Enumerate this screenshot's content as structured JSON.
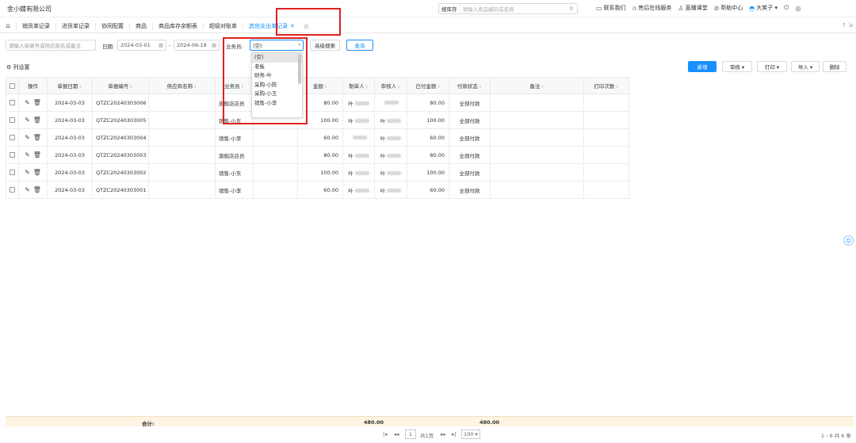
{
  "company": "金小蝶有限公司",
  "top_search": {
    "scope": "搜库存",
    "placeholder": "请输入商品编码或名称"
  },
  "top_links": [
    {
      "icon": "message-icon",
      "label": "联系我们"
    },
    {
      "icon": "headset-icon",
      "label": "售后在线服务"
    },
    {
      "icon": "live-icon",
      "label": "直播课堂"
    },
    {
      "icon": "help-icon",
      "label": "帮助中心"
    },
    {
      "icon": "user-icon",
      "label": "大笑子 ▾"
    }
  ],
  "tabs": [
    {
      "label": "销货单记录",
      "active": false
    },
    {
      "label": "进货单记录",
      "active": false
    },
    {
      "label": "协同配置",
      "active": false
    },
    {
      "label": "商品",
      "active": false
    },
    {
      "label": "商品库存余额表",
      "active": false
    },
    {
      "label": "超级对账单",
      "active": false
    },
    {
      "label": "其他支出单记录",
      "active": true
    }
  ],
  "tabbar_right": "↑ ⇲",
  "filter": {
    "keyword_placeholder": "请输入单据号或供应商名或备注",
    "date_label": "日期:",
    "date_from": "2024-03-01",
    "date_sep": "-",
    "date_to": "2024-06-18",
    "salesperson_label": "业务员:",
    "salesperson_value": "(空)",
    "advanced_search": "高级搜索",
    "query": "查询"
  },
  "salesperson_options": [
    "(空)",
    "老板",
    "财务-叶",
    "采购-小陈",
    "采购-小王",
    "销售-小李"
  ],
  "column_settings": "列设置",
  "actions": {
    "new": "新增",
    "audit": "审核 ▾",
    "print": "打印 ▾",
    "import": "导入 ▾",
    "delete": "删除"
  },
  "columns": [
    "操作",
    "单据日期",
    "单据编号",
    "供应商名称",
    "业务员",
    "部门",
    "金额",
    "制单人",
    "审核人",
    "已付金额",
    "付款状态",
    "备注",
    "打印次数"
  ],
  "rows": [
    {
      "date": "2024-03-03",
      "no": "QTZC20240303006",
      "supplier": "",
      "salesperson": "旗舰店店员",
      "dept": "",
      "amount": "80.00",
      "maker": "叶",
      "auditor": "",
      "paid": "80.00",
      "status": "全部付款",
      "remark": "",
      "prints": ""
    },
    {
      "date": "2024-03-03",
      "no": "QTZC20240303005",
      "supplier": "",
      "salesperson": "销售-小东",
      "dept": "",
      "amount": "100.00",
      "maker": "叶",
      "auditor": "叶",
      "paid": "100.00",
      "status": "全部付款",
      "remark": "",
      "prints": ""
    },
    {
      "date": "2024-03-03",
      "no": "QTZC20240303004",
      "supplier": "",
      "salesperson": "销售-小李",
      "dept": "",
      "amount": "60.00",
      "maker": "",
      "auditor": "叶",
      "paid": "60.00",
      "status": "全部付款",
      "remark": "",
      "prints": ""
    },
    {
      "date": "2024-03-03",
      "no": "QTZC20240303003",
      "supplier": "",
      "salesperson": "旗舰店店员",
      "dept": "",
      "amount": "80.00",
      "maker": "叶",
      "auditor": "叶",
      "paid": "80.00",
      "status": "全部付款",
      "remark": "",
      "prints": ""
    },
    {
      "date": "2024-03-03",
      "no": "QTZC20240303002",
      "supplier": "",
      "salesperson": "销售-小东",
      "dept": "",
      "amount": "100.00",
      "maker": "叶",
      "auditor": "叶",
      "paid": "100.00",
      "status": "全部付款",
      "remark": "",
      "prints": ""
    },
    {
      "date": "2024-03-03",
      "no": "QTZC20240303001",
      "supplier": "",
      "salesperson": "销售-小李",
      "dept": "",
      "amount": "60.00",
      "maker": "叶",
      "auditor": "叶",
      "paid": "60.00",
      "status": "全部付款",
      "remark": "",
      "prints": ""
    }
  ],
  "totals": {
    "label": "合计:",
    "amount": "480.00",
    "paid": "480.00"
  },
  "pager": {
    "first": "|◂",
    "prev": "◂◂",
    "page": "1",
    "total_pages": "共1页",
    "next": "▸▸",
    "last": "▸|",
    "page_size": "100",
    "summary": "1 - 6  共 6 条"
  },
  "colors": {
    "accent": "#1890ff",
    "highlight_box": "#e02020",
    "total_bg": "#fdf4e3"
  }
}
